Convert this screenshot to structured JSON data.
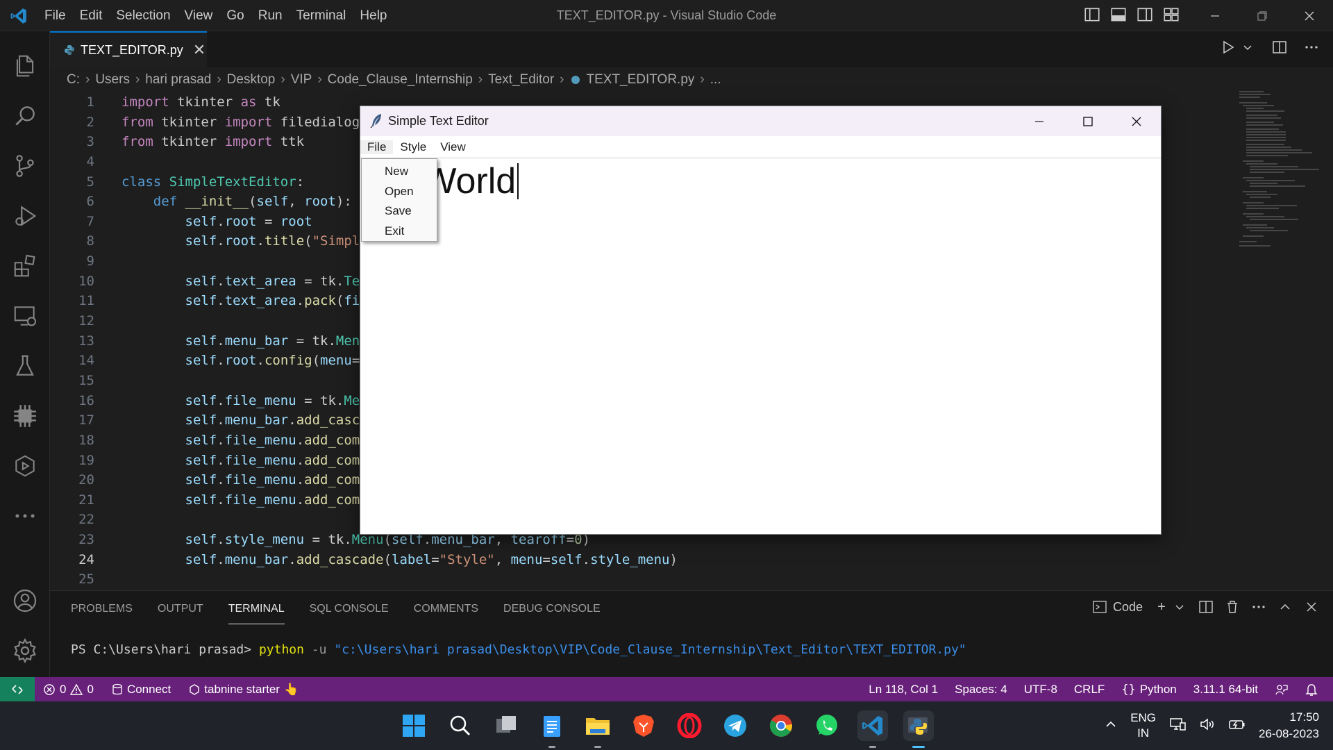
{
  "vscode": {
    "window_title": "TEXT_EDITOR.py - Visual Studio Code",
    "menu": [
      "File",
      "Edit",
      "Selection",
      "View",
      "Go",
      "Run",
      "Terminal",
      "Help"
    ],
    "tab": {
      "label": "TEXT_EDITOR.py",
      "close": "✕"
    },
    "breadcrumb": [
      "C:",
      "Users",
      "hari prasad",
      "Desktop",
      "VIP",
      "Code_Clause_Internship",
      "Text_Editor",
      "TEXT_EDITOR.py",
      "..."
    ],
    "code_lines": [
      {
        "n": "1"
      },
      {
        "n": "2"
      },
      {
        "n": "3"
      },
      {
        "n": "4"
      },
      {
        "n": "5"
      },
      {
        "n": "6"
      },
      {
        "n": "7"
      },
      {
        "n": "8"
      },
      {
        "n": "9"
      },
      {
        "n": "10"
      },
      {
        "n": "11"
      },
      {
        "n": "12"
      },
      {
        "n": "13"
      },
      {
        "n": "14"
      },
      {
        "n": "15"
      },
      {
        "n": "16"
      },
      {
        "n": "17"
      },
      {
        "n": "18"
      },
      {
        "n": "19"
      },
      {
        "n": "20"
      },
      {
        "n": "21"
      },
      {
        "n": "22"
      },
      {
        "n": "23"
      },
      {
        "n": "24"
      },
      {
        "n": "25"
      }
    ],
    "panel": {
      "tabs": [
        "PROBLEMS",
        "OUTPUT",
        "TERMINAL",
        "SQL CONSOLE",
        "COMMENTS",
        "DEBUG CONSOLE"
      ],
      "active_tab": "TERMINAL",
      "terminal_profile": "Code",
      "terminal": {
        "prompt": "PS C:\\Users\\hari prasad> ",
        "command": "python",
        "flag": " -u ",
        "path": "\"c:\\Users\\hari prasad\\Desktop\\VIP\\Code_Clause_Internship\\Text_Editor\\TEXT_EDITOR.py\""
      }
    },
    "status": {
      "errors": "0",
      "warnings": "0",
      "connect": "Connect",
      "tabnine": "tabnine starter",
      "tabnine_emoji": "👆",
      "position": "Ln 118, Col 1",
      "spaces": "Spaces: 4",
      "encoding": "UTF-8",
      "eol": "CRLF",
      "language": "Python",
      "interpreter": "3.11.1 64-bit"
    }
  },
  "tk_app": {
    "title": "Simple Text Editor",
    "menu": [
      "File",
      "Style",
      "View"
    ],
    "file_menu_items": [
      "New",
      "Open",
      "Save",
      "Exit"
    ],
    "text_content": "o World"
  },
  "taskbar": {
    "lang_line1": "ENG",
    "lang_line2": "IN",
    "time": "17:50",
    "date": "26-08-2023"
  },
  "colors": {
    "statusbar": "#68217a",
    "remote": "#16825d",
    "accent": "#0078d4"
  }
}
